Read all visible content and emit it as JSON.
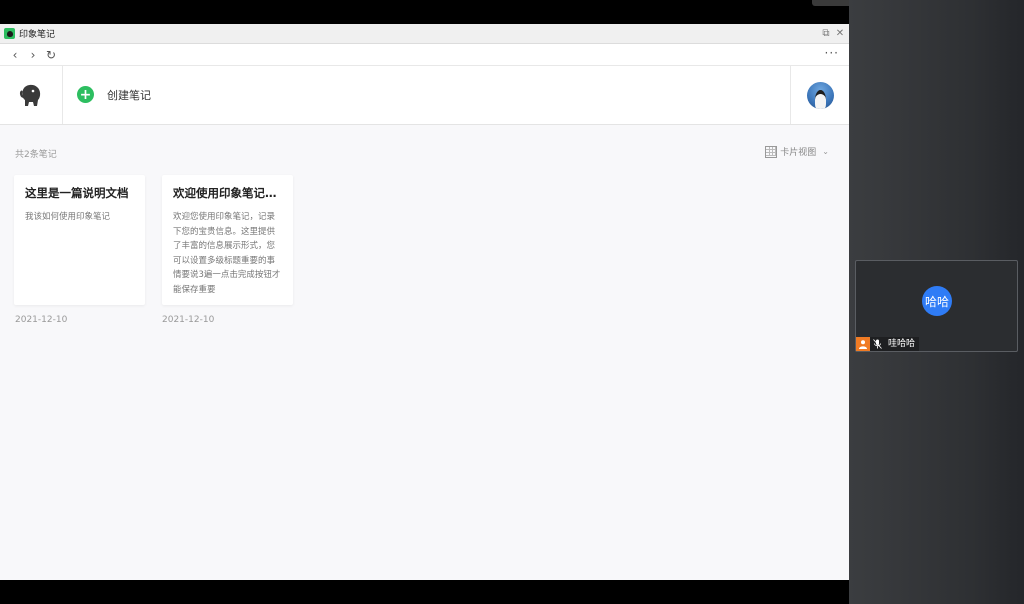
{
  "window": {
    "title": "印象笔记",
    "controls": {
      "restore": "⧉",
      "close": "✕"
    }
  },
  "nav": {
    "back": "‹",
    "forward": "›",
    "refresh": "↻",
    "more": "···"
  },
  "header": {
    "create_label": "创建笔记"
  },
  "list": {
    "count_text": "共2条笔记",
    "view_label": "卡片视图",
    "notes": [
      {
        "title": "这里是一篇说明文档",
        "body": "我该如何使用印象笔记",
        "date": "2021-12-10"
      },
      {
        "title": "欢迎使用印象笔记…",
        "body": "欢迎您使用印象笔记，记录下您的宝贵信息。这里提供了丰富的信息展示形式，您可以设置多级标题重要的事情要说3遍一点击完成按钮才能保存重要",
        "date": "2021-12-10"
      }
    ]
  },
  "meeting": {
    "avatar_text": "哈哈",
    "participant_name": "哇哈哈"
  },
  "colors": {
    "accent_green": "#2dbe60",
    "meeting_blue": "#2f7cf6",
    "host_orange": "#f07b24"
  }
}
